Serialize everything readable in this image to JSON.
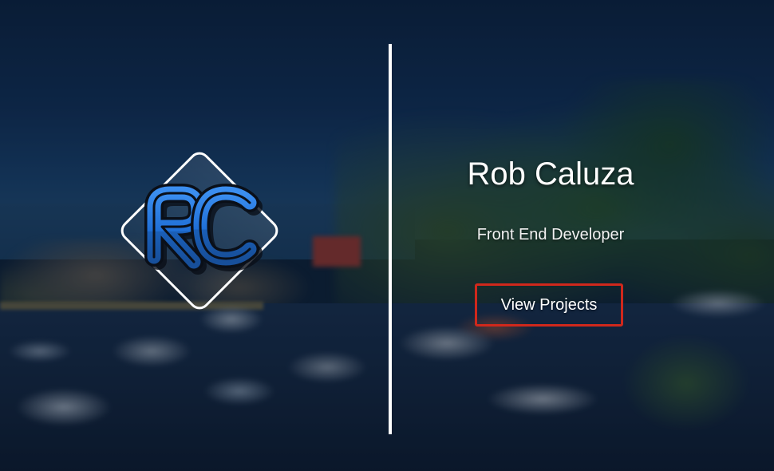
{
  "logo": {
    "monogram_letters": [
      "R",
      "C"
    ],
    "colors": {
      "blue": "#1f6fd6",
      "blue_light": "#3b8ef0",
      "outline": "#ffffff",
      "shadow": "#0a0f18"
    }
  },
  "hero": {
    "name": "Rob Caluza",
    "title": "Front End Developer",
    "cta_label": "View Projects"
  },
  "colors": {
    "cta_border": "#d0281c",
    "text": "#ffffff",
    "divider": "#ffffff"
  }
}
